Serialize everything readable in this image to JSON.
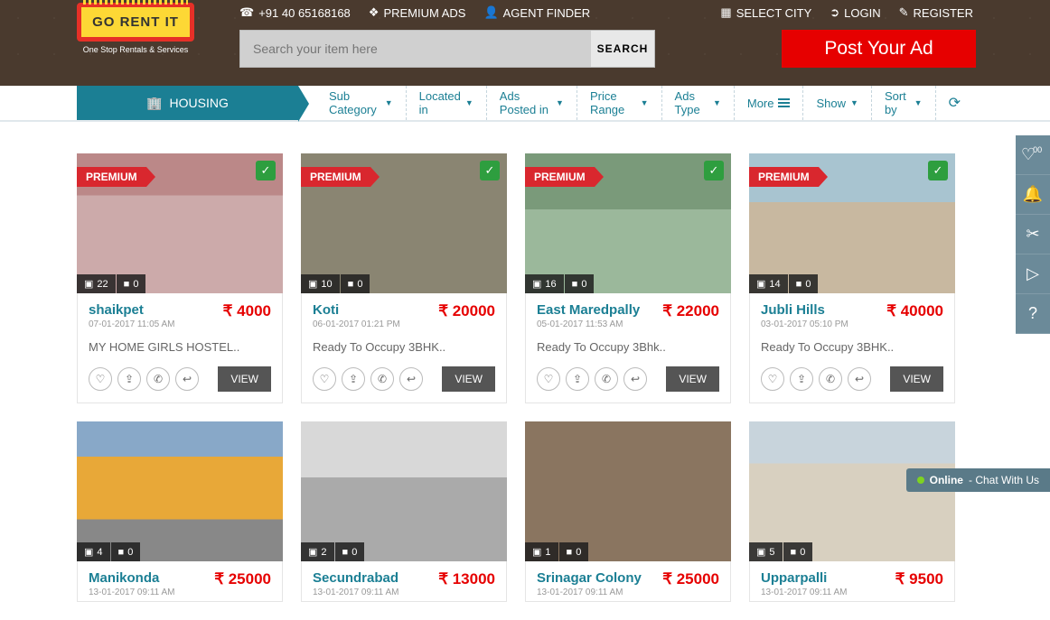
{
  "header": {
    "phone": "+91 40 65168168",
    "premium_ads": "PREMIUM ADS",
    "agent_finder": "AGENT FINDER",
    "select_city": "SELECT CITY",
    "login": "LOGIN",
    "register": "REGISTER",
    "logo_main": "GO RENT IT",
    "logo_tag": "One Stop Rentals & Services",
    "search_placeholder": "Search your item here",
    "search_btn": "SEARCH",
    "post_ad": "Post Your Ad"
  },
  "nav": {
    "housing": "HOUSING",
    "filters": [
      "Sub Category",
      "Located in",
      "Ads Posted in",
      "Price Range",
      "Ads Type",
      "More",
      "Show",
      "Sort by"
    ]
  },
  "listings": [
    {
      "premium": true,
      "photos": 22,
      "videos": 0,
      "title": "shaikpet",
      "date": "07-01-2017 11:05 AM",
      "price": "₹ 4000",
      "desc": "MY HOME GIRLS HOSTEL..",
      "view": "VIEW",
      "img": "img1"
    },
    {
      "premium": true,
      "photos": 10,
      "videos": 0,
      "title": "Koti",
      "date": "06-01-2017 01:21 PM",
      "price": "₹ 20000",
      "desc": "Ready To Occupy 3BHK..",
      "view": "VIEW",
      "img": "img2"
    },
    {
      "premium": true,
      "photos": 16,
      "videos": 0,
      "title": "East Maredpally",
      "date": "05-01-2017 11:53 AM",
      "price": "₹ 22000",
      "desc": "Ready To Occupy 3Bhk..",
      "view": "VIEW",
      "img": "img3"
    },
    {
      "premium": true,
      "photos": 14,
      "videos": 0,
      "title": "Jubli Hills",
      "date": "03-01-2017 05:10 PM",
      "price": "₹ 40000",
      "desc": "Ready To Occupy 3BHK..",
      "view": "VIEW",
      "img": "img4"
    },
    {
      "premium": false,
      "photos": 4,
      "videos": 0,
      "title": "Manikonda",
      "date": "13-01-2017 09:11 AM",
      "price": "₹ 25000",
      "desc": "",
      "view": "",
      "img": "img5"
    },
    {
      "premium": false,
      "photos": 2,
      "videos": 0,
      "title": "Secundrabad",
      "date": "13-01-2017 09:11 AM",
      "price": "₹ 13000",
      "desc": "",
      "view": "",
      "img": "img6"
    },
    {
      "premium": false,
      "photos": 1,
      "videos": 0,
      "title": "Srinagar Colony",
      "date": "13-01-2017 09:11 AM",
      "price": "₹ 25000",
      "desc": "",
      "view": "",
      "img": "img7"
    },
    {
      "premium": false,
      "photos": 5,
      "videos": 0,
      "title": "Upparpalli",
      "date": "13-01-2017 09:11 AM",
      "price": "₹ 9500",
      "desc": "",
      "view": "",
      "img": "img8"
    }
  ],
  "sidebar": {
    "wish_count": "00"
  },
  "chat": {
    "online": "Online",
    "text": " - Chat With Us"
  },
  "premium_label": "PREMIUM"
}
